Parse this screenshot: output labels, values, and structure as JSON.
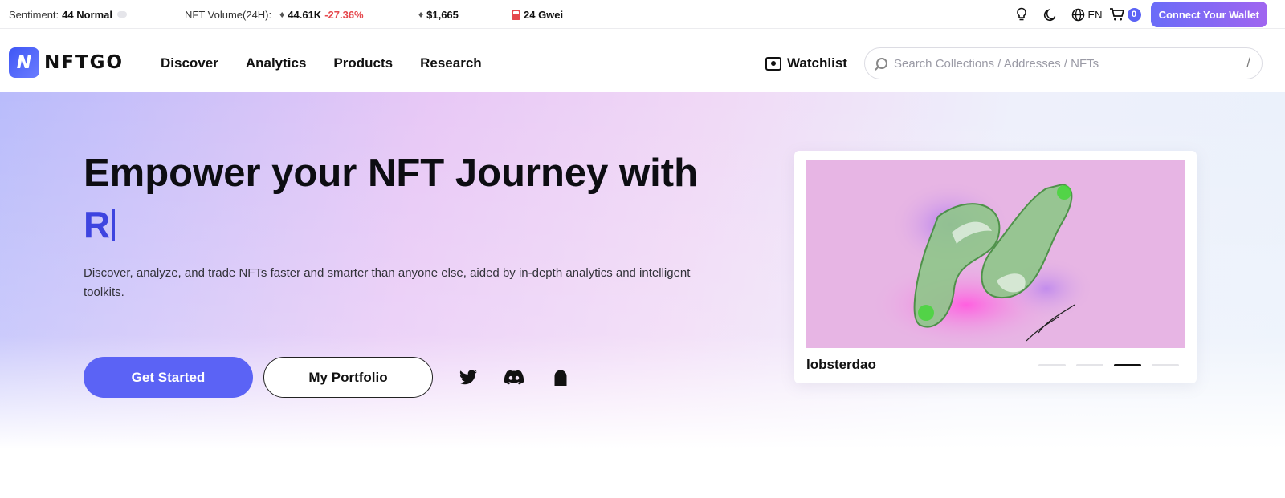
{
  "ticker": {
    "sentiment_label": "Sentiment:",
    "sentiment_value": "44 Normal",
    "volume_label": "NFT Volume(24H):",
    "volume_value": "44.61K",
    "volume_change": "-27.36%",
    "eth_price": "$1,665",
    "gas": "24 Gwei",
    "language": "EN",
    "cart_count": "0",
    "connect_label": "Connect Your Wallet"
  },
  "nav": {
    "logo_text": "NFTGO",
    "logo_letter": "N",
    "menu": [
      "Discover",
      "Analytics",
      "Products",
      "Research"
    ],
    "watchlist_label": "Watchlist",
    "search_placeholder": "Search Collections / Addresses / NFTs",
    "search_shortcut": "/"
  },
  "hero": {
    "title": "Empower your NFT Journey with",
    "typed_text": "R",
    "description": "Discover, analyze, and trade NFTs faster and smarter than anyone else, aided by in-depth analytics and intelligent toolkits.",
    "primary_button": "Get Started",
    "secondary_button": "My Portfolio",
    "social_icons": [
      "twitter-icon",
      "discord-icon",
      "ghost-icon"
    ]
  },
  "card": {
    "title": "lobsterdao",
    "carousel_active_index": 2,
    "carousel_count": 4
  },
  "colors": {
    "accent": "#5b63f5",
    "typed": "#3e44e0",
    "negative": "#e5484d",
    "art_background": "#e7b5e4"
  }
}
